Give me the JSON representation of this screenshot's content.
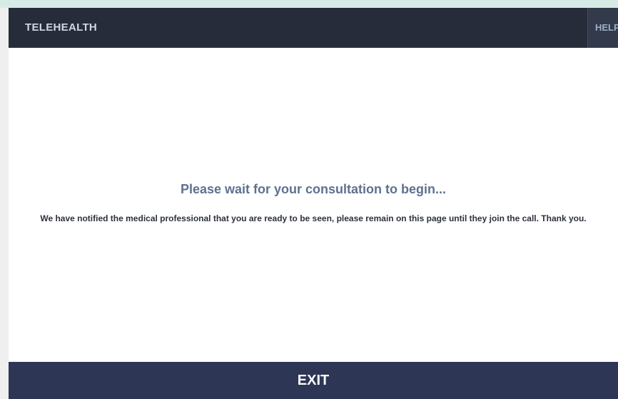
{
  "header": {
    "brand": "TELEHEALTH",
    "help_label": "HELP"
  },
  "main": {
    "title": "Please wait for your consultation to begin...",
    "message": "We have notified the medical professional that you are ready to be seen, please remain on this page until they join the call. Thank you."
  },
  "footer": {
    "exit_label": "EXIT"
  },
  "colors": {
    "header_bg": "#272c3a",
    "footer_bg": "#2d3655",
    "title_text": "#5e7190"
  }
}
